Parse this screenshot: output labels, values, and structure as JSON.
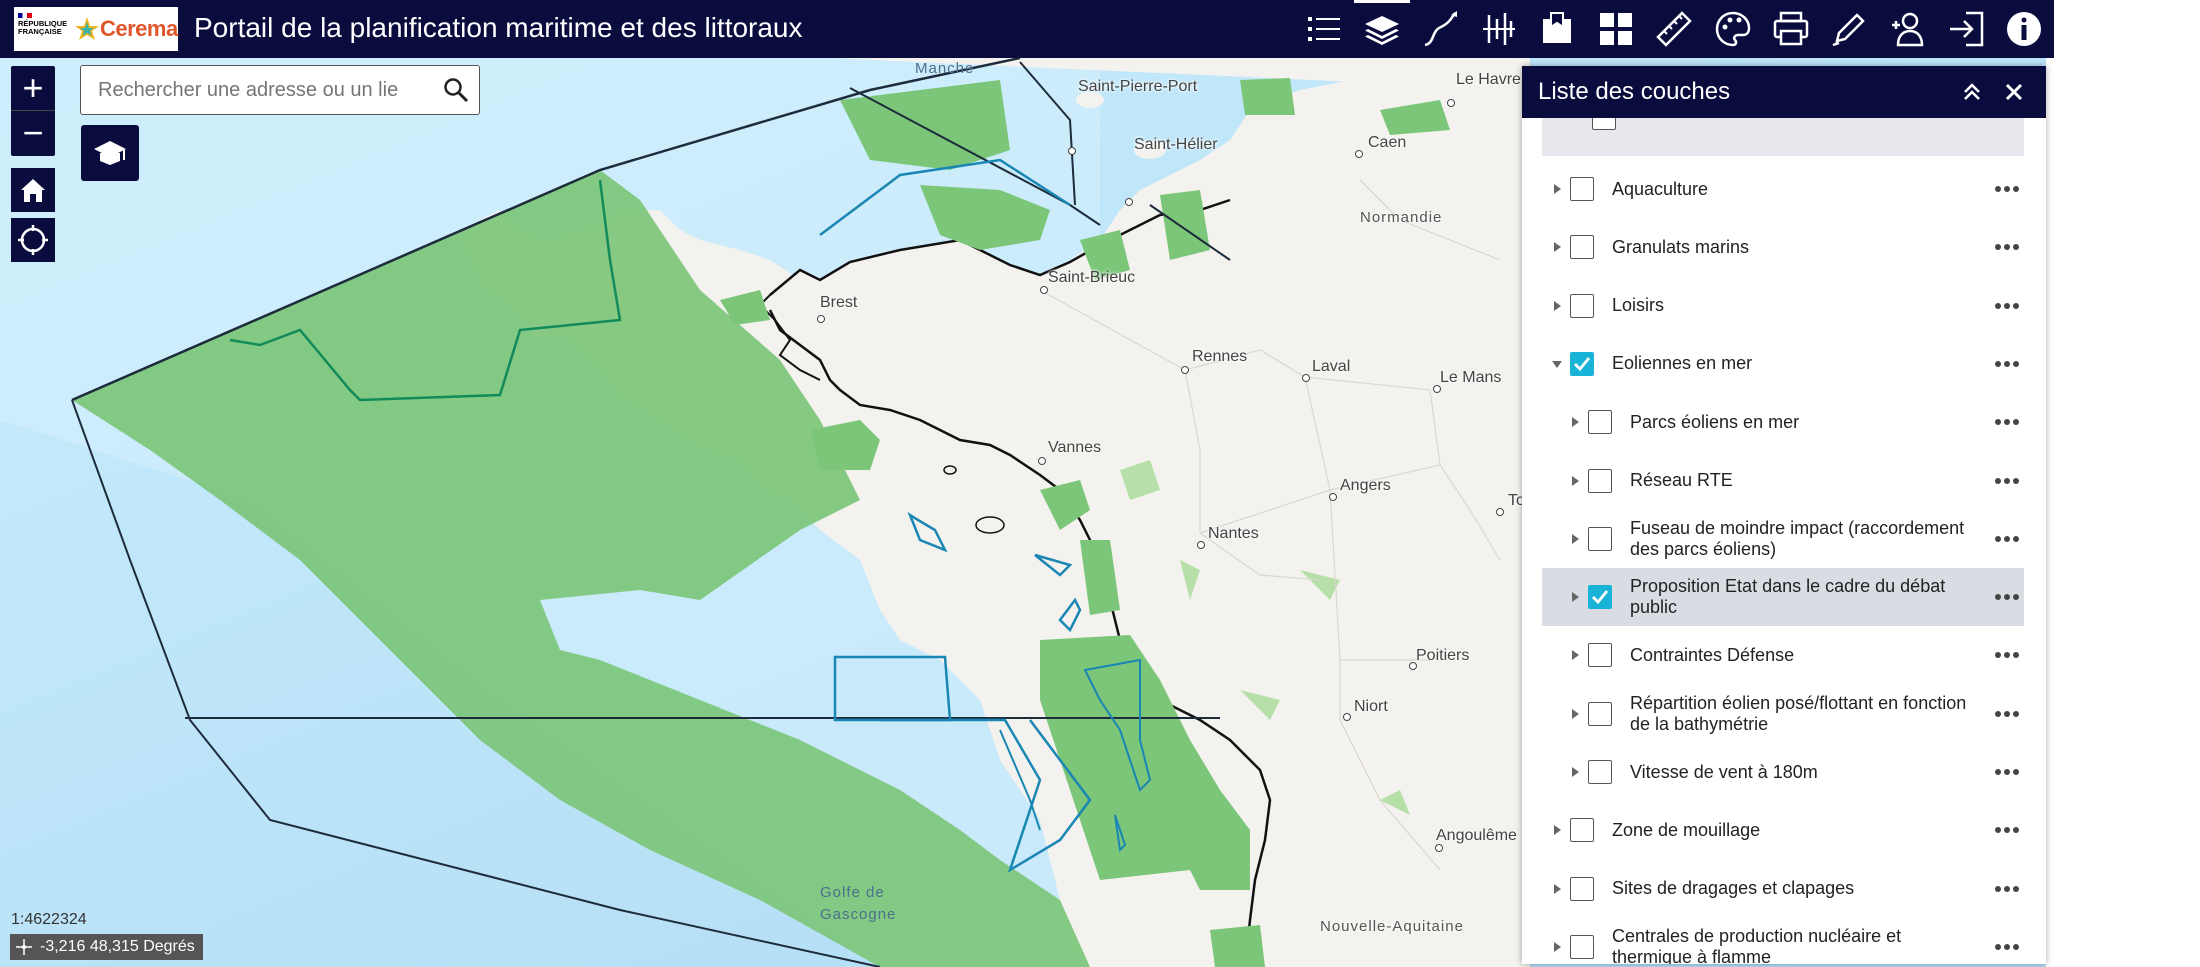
{
  "header": {
    "title": "Portail de la planification maritime et des littoraux",
    "logo_rf_text": "RÉPUBLIQUE FRANÇAISE",
    "logo_cerema_text": "Cerema",
    "background": "#0b0c3e",
    "tools": [
      {
        "name": "legend-list",
        "active": false
      },
      {
        "name": "layers",
        "active": true
      },
      {
        "name": "draw-line",
        "active": false
      },
      {
        "name": "measure-profile",
        "active": false
      },
      {
        "name": "bookmark-add",
        "active": false
      },
      {
        "name": "basemap-gallery",
        "active": false
      },
      {
        "name": "ruler",
        "active": false
      },
      {
        "name": "style-palette",
        "active": false
      },
      {
        "name": "print",
        "active": false
      },
      {
        "name": "edit-pen",
        "active": false
      },
      {
        "name": "add-user",
        "active": false
      },
      {
        "name": "login",
        "active": false
      },
      {
        "name": "info",
        "active": false
      }
    ]
  },
  "search": {
    "placeholder": "Rechercher une adresse ou un lie"
  },
  "map": {
    "scale": "1:4622324",
    "coordinates": "-3,216 48,315 Degrés",
    "labels": {
      "manche": "Manche",
      "saint_pierre_port": "Saint-Pierre-Port",
      "saint_helier": "Saint-Hélier",
      "le_havre": "Le Havre",
      "caen": "Caen",
      "normandie": "Normandie",
      "brest": "Brest",
      "saint_brieuc": "Saint-Brieuc",
      "rennes": "Rennes",
      "laval": "Laval",
      "le_mans": "Le Mans",
      "vannes": "Vannes",
      "angers": "Angers",
      "nantes": "Nantes",
      "tours": "To",
      "poitiers": "Poitiers",
      "niort": "Niort",
      "angouleme": "Angoulême",
      "nouvelle_aquitaine": "Nouvelle-Aquitaine",
      "golfe": "Golfe de",
      "gascogne": "Gascogne"
    },
    "colors": {
      "sea": "#b9e2f8",
      "land": "#f3f2ee",
      "zone_green": "#7cc679",
      "outline_dark": "#1d2b3a",
      "outline_blue": "#1a86b4"
    }
  },
  "layer_panel": {
    "title": "Liste des couches",
    "rows": [
      {
        "label": "Aquaculture",
        "checked": false,
        "level": 0,
        "expanded": false,
        "selected": false
      },
      {
        "label": "Granulats marins",
        "checked": false,
        "level": 0,
        "expanded": false,
        "selected": false
      },
      {
        "label": "Loisirs",
        "checked": false,
        "level": 0,
        "expanded": false,
        "selected": false
      },
      {
        "label": "Eoliennes en mer",
        "checked": true,
        "level": 0,
        "expanded": true,
        "selected": false
      },
      {
        "label": "Parcs éoliens en mer",
        "checked": false,
        "level": 1,
        "expanded": false,
        "selected": false
      },
      {
        "label": "Réseau RTE",
        "checked": false,
        "level": 1,
        "expanded": false,
        "selected": false
      },
      {
        "label": "Fuseau de moindre impact (raccordement des parcs éoliens)",
        "checked": false,
        "level": 1,
        "expanded": false,
        "selected": false
      },
      {
        "label": "Proposition Etat dans le cadre du débat public",
        "checked": true,
        "level": 1,
        "expanded": false,
        "selected": true
      },
      {
        "label": "Contraintes Défense",
        "checked": false,
        "level": 1,
        "expanded": false,
        "selected": false
      },
      {
        "label": "Répartition éolien posé/flottant en fonction de la bathymétrie",
        "checked": false,
        "level": 1,
        "expanded": false,
        "selected": false
      },
      {
        "label": "Vitesse de vent à 180m",
        "checked": false,
        "level": 1,
        "expanded": false,
        "selected": false
      },
      {
        "label": "Zone de mouillage",
        "checked": false,
        "level": 0,
        "expanded": false,
        "selected": false
      },
      {
        "label": "Sites de dragages et clapages",
        "checked": false,
        "level": 0,
        "expanded": false,
        "selected": false
      },
      {
        "label": "Centrales de production nucléaire et thermique à flamme",
        "checked": false,
        "level": 0,
        "expanded": false,
        "selected": false
      }
    ],
    "accent": "#1ab3d8"
  }
}
